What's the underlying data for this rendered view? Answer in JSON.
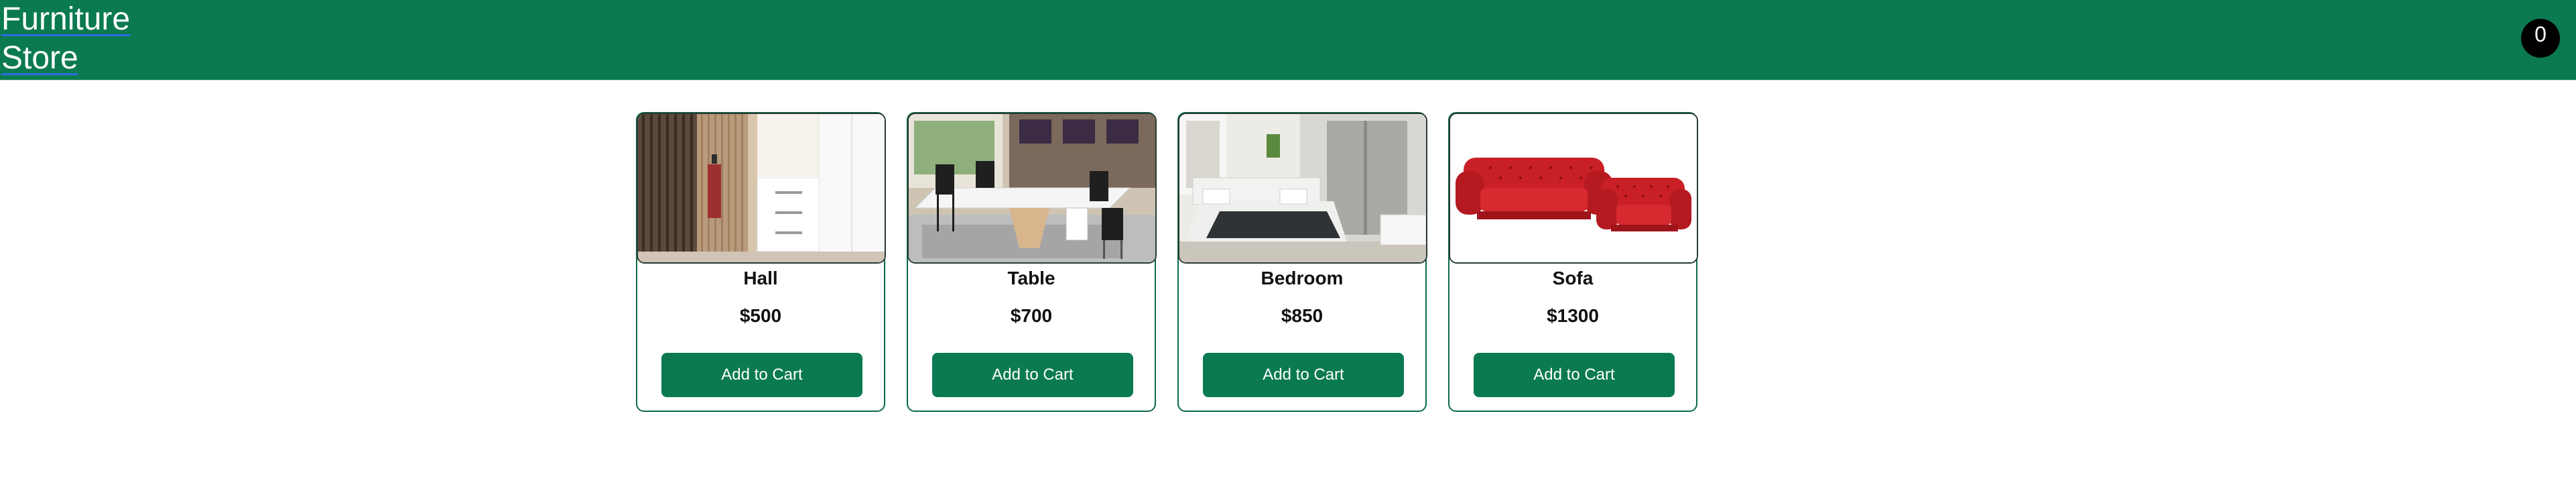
{
  "header": {
    "brand": "Furniture\nStore",
    "cart_count": "0"
  },
  "products": [
    {
      "name": "Hall",
      "price": "$500",
      "button": "Add to Cart",
      "image": "hall-furniture-image"
    },
    {
      "name": "Table",
      "price": "$700",
      "button": "Add to Cart",
      "image": "dining-table-image"
    },
    {
      "name": "Bedroom",
      "price": "$850",
      "button": "Add to Cart",
      "image": "bedroom-set-image"
    },
    {
      "name": "Sofa",
      "price": "$1300",
      "button": "Add to Cart",
      "image": "red-sofa-image"
    }
  ],
  "colors": {
    "brand_green": "#0b7a51",
    "card_border": "#0b6a45",
    "badge": "#000000"
  }
}
